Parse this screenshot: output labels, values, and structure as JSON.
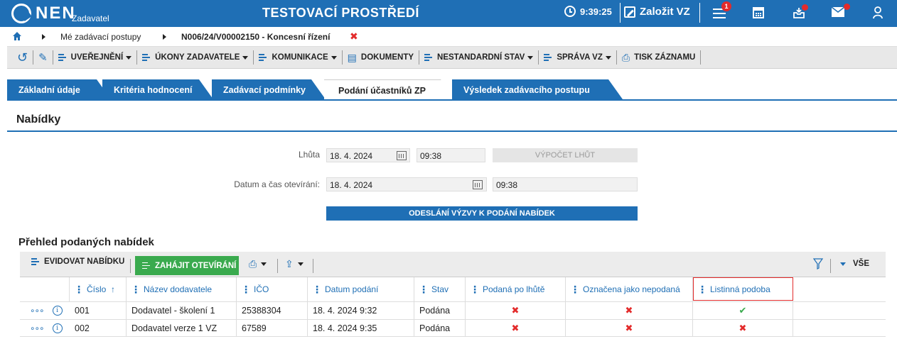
{
  "topbar": {
    "logo_text": "NEN",
    "logo_sub": "Zadavatel",
    "title": "TESTOVACÍ PROSTŘEDÍ",
    "time": "9:39:25",
    "zalozit": "Založit VZ",
    "menu_badge": "1",
    "icons": [
      "clock-icon",
      "edit-icon",
      "menu-icon",
      "calculator-icon",
      "inbox-icon",
      "mail-icon",
      "user-icon"
    ]
  },
  "breadcrumb": {
    "item1": "Mé zadávací postupy",
    "item2": "N006/24/V00002150 - Koncesní řízení",
    "close": "✖"
  },
  "toolbar": {
    "items": [
      "UVEŘEJNĚNÍ",
      "ÚKONY ZADAVATELE",
      "KOMUNIKACE",
      "DOKUMENTY",
      "NESTANDARDNÍ STAV",
      "SPRÁVA VZ",
      "TISK ZÁZNAMU"
    ]
  },
  "tabs": [
    "Základní údaje",
    "Kritéria hodnocení",
    "Zadávací podmínky",
    "Podání účastníků ZP",
    "Výsledek zadávacího postupu"
  ],
  "nabidky": {
    "title": "Nabídky",
    "lhuta_label": "Lhůta",
    "lhuta_date": "18. 4. 2024",
    "lhuta_time": "09:38",
    "vypocet": "VÝPOČET LHŮT",
    "otevirani_label": "Datum a čas otevírání:",
    "otevirani_date": "18. 4. 2024",
    "otevirani_time": "09:38",
    "odeslani": "ODESLÁNÍ VÝZVY K PODÁNÍ NABÍDEK"
  },
  "prehled": {
    "title": "Přehled podaných nabídek",
    "evidovat": "EVIDOVAT NABÍDKU",
    "zahajit": "ZAHÁJIT OTEVÍRÁNÍ",
    "vse": "VŠE",
    "columns": [
      "Číslo",
      "Název dodavatele",
      "IČO",
      "Datum podání",
      "Stav",
      "Podaná po lhůtě",
      "Označena jako nepodaná",
      "Listinná podoba"
    ],
    "sort_indicator": "↑",
    "rows": [
      {
        "cislo": "001",
        "nazev": "Dodavatel - školení 1",
        "ico": "25388304",
        "datum": "18. 4. 2024 9:32",
        "stav": "Podána",
        "po_lhute": "✖",
        "nepodana": "✖",
        "listinna": "✔"
      },
      {
        "cislo": "002",
        "nazev": "Dodavatel verze 1 VZ",
        "ico": "67589",
        "datum": "18. 4. 2024 9:35",
        "stav": "Podána",
        "po_lhute": "✖",
        "nepodana": "✖",
        "listinna": "✖"
      }
    ]
  },
  "colors": {
    "brand": "#1f6fb5",
    "green": "#3aaa4e",
    "red": "#e32b2b"
  }
}
